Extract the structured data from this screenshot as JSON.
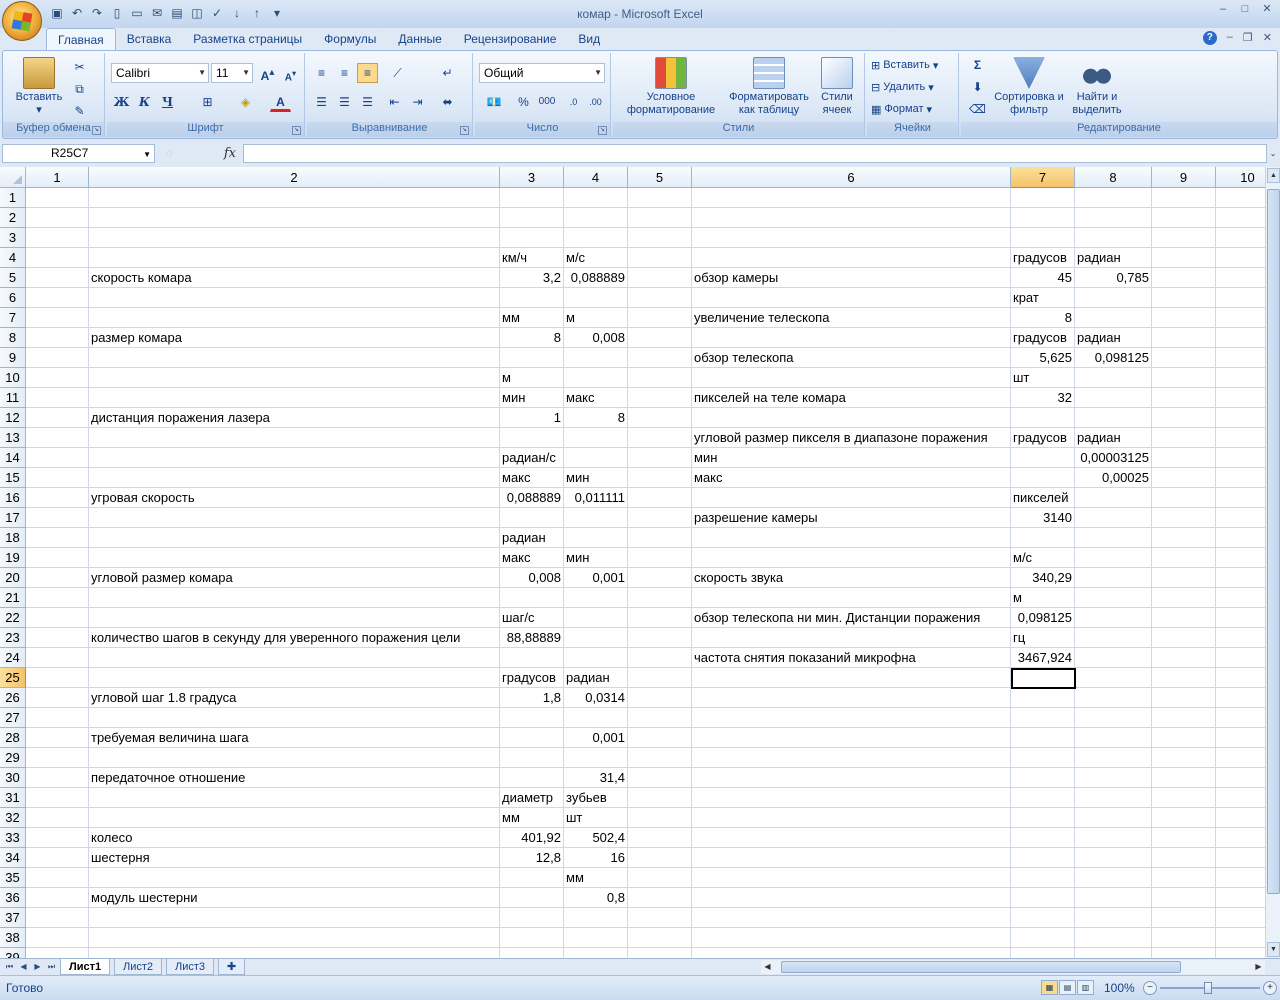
{
  "window": {
    "title": "комар - Microsoft Excel"
  },
  "ribbon": {
    "tabs": [
      "Главная",
      "Вставка",
      "Разметка страницы",
      "Формулы",
      "Данные",
      "Рецензирование",
      "Вид"
    ],
    "clipboard": {
      "paste": "Вставить",
      "label": "Буфер обмена"
    },
    "font": {
      "name": "Calibri",
      "size": "11",
      "label": "Шрифт",
      "bold": "Ж",
      "italic": "К",
      "underline": "Ч"
    },
    "alignment": {
      "label": "Выравнивание"
    },
    "number": {
      "format": "Общий",
      "label": "Число",
      "percent": "%",
      "thousands": "000"
    },
    "styles": {
      "conditional": "Условное форматирование",
      "as_table": "Форматировать как таблицу",
      "cell_styles": "Стили ячеек",
      "label": "Стили"
    },
    "cells": {
      "insert": "Вставить",
      "delete": "Удалить",
      "format": "Формат",
      "label": "Ячейки"
    },
    "editing": {
      "sort": "Сортировка и фильтр",
      "find": "Найти и выделить",
      "label": "Редактирование"
    }
  },
  "formula_bar": {
    "name_box": "R25C7",
    "fx": "fx",
    "formula": ""
  },
  "columns": [
    "1",
    "2",
    "3",
    "4",
    "5",
    "6",
    "7",
    "8",
    "9",
    "10"
  ],
  "rows": [
    "1",
    "2",
    "3",
    "4",
    "5",
    "6",
    "7",
    "8",
    "9",
    "10",
    "11",
    "12",
    "13",
    "14",
    "15",
    "16",
    "17",
    "18",
    "19",
    "20",
    "21",
    "22",
    "23",
    "24",
    "25",
    "26",
    "27",
    "28",
    "29",
    "30",
    "31",
    "32",
    "33",
    "34",
    "35",
    "36",
    "37",
    "38",
    "39"
  ],
  "selected": {
    "row": "25",
    "col": "7"
  },
  "cells": [
    {
      "r": 4,
      "c": 3,
      "v": "км/ч",
      "t": "s"
    },
    {
      "r": 4,
      "c": 4,
      "v": "м/с",
      "t": "s"
    },
    {
      "r": 4,
      "c": 7,
      "v": "градусов",
      "t": "s"
    },
    {
      "r": 4,
      "c": 8,
      "v": "радиан",
      "t": "s"
    },
    {
      "r": 5,
      "c": 2,
      "v": "скорость комара",
      "t": "s"
    },
    {
      "r": 5,
      "c": 3,
      "v": "3,2",
      "t": "n"
    },
    {
      "r": 5,
      "c": 4,
      "v": "0,088889",
      "t": "n"
    },
    {
      "r": 5,
      "c": 6,
      "v": "обзор камеры",
      "t": "s"
    },
    {
      "r": 5,
      "c": 7,
      "v": "45",
      "t": "n"
    },
    {
      "r": 5,
      "c": 8,
      "v": "0,785",
      "t": "n"
    },
    {
      "r": 6,
      "c": 7,
      "v": "крат",
      "t": "s"
    },
    {
      "r": 7,
      "c": 3,
      "v": "мм",
      "t": "s"
    },
    {
      "r": 7,
      "c": 4,
      "v": "м",
      "t": "s"
    },
    {
      "r": 7,
      "c": 6,
      "v": "увеличение телескопа",
      "t": "s"
    },
    {
      "r": 7,
      "c": 7,
      "v": "8",
      "t": "n"
    },
    {
      "r": 8,
      "c": 2,
      "v": "размер комара",
      "t": "s"
    },
    {
      "r": 8,
      "c": 3,
      "v": "8",
      "t": "n"
    },
    {
      "r": 8,
      "c": 4,
      "v": "0,008",
      "t": "n"
    },
    {
      "r": 8,
      "c": 7,
      "v": "градусов",
      "t": "s"
    },
    {
      "r": 8,
      "c": 8,
      "v": "радиан",
      "t": "s"
    },
    {
      "r": 9,
      "c": 6,
      "v": "обзор телескопа",
      "t": "s"
    },
    {
      "r": 9,
      "c": 7,
      "v": "5,625",
      "t": "n"
    },
    {
      "r": 9,
      "c": 8,
      "v": "0,098125",
      "t": "n"
    },
    {
      "r": 10,
      "c": 3,
      "v": "м",
      "t": "s"
    },
    {
      "r": 10,
      "c": 7,
      "v": "шт",
      "t": "s"
    },
    {
      "r": 11,
      "c": 3,
      "v": "мин",
      "t": "s"
    },
    {
      "r": 11,
      "c": 4,
      "v": "макс",
      "t": "s"
    },
    {
      "r": 11,
      "c": 6,
      "v": "пикселей на теле комара",
      "t": "s"
    },
    {
      "r": 11,
      "c": 7,
      "v": "32",
      "t": "n"
    },
    {
      "r": 12,
      "c": 2,
      "v": "дистанция поражения лазера",
      "t": "s"
    },
    {
      "r": 12,
      "c": 3,
      "v": "1",
      "t": "n"
    },
    {
      "r": 12,
      "c": 4,
      "v": "8",
      "t": "n"
    },
    {
      "r": 13,
      "c": 6,
      "v": "угловой размер пикселя в диапазоне поражения",
      "t": "s"
    },
    {
      "r": 13,
      "c": 7,
      "v": "градусов",
      "t": "s"
    },
    {
      "r": 13,
      "c": 8,
      "v": "радиан",
      "t": "s"
    },
    {
      "r": 14,
      "c": 3,
      "v": "радиан/с",
      "t": "s"
    },
    {
      "r": 14,
      "c": 6,
      "v": "мин",
      "t": "s"
    },
    {
      "r": 14,
      "c": 8,
      "v": "0,00003125",
      "t": "n"
    },
    {
      "r": 15,
      "c": 3,
      "v": "макс",
      "t": "s"
    },
    {
      "r": 15,
      "c": 4,
      "v": "мин",
      "t": "s"
    },
    {
      "r": 15,
      "c": 6,
      "v": "макс",
      "t": "s"
    },
    {
      "r": 15,
      "c": 8,
      "v": "0,00025",
      "t": "n"
    },
    {
      "r": 16,
      "c": 2,
      "v": "угровая скорость",
      "t": "s"
    },
    {
      "r": 16,
      "c": 3,
      "v": "0,088889",
      "t": "n"
    },
    {
      "r": 16,
      "c": 4,
      "v": "0,011111",
      "t": "n"
    },
    {
      "r": 16,
      "c": 7,
      "v": "пикселей",
      "t": "s"
    },
    {
      "r": 17,
      "c": 6,
      "v": "разрешение камеры",
      "t": "s"
    },
    {
      "r": 17,
      "c": 7,
      "v": "3140",
      "t": "n"
    },
    {
      "r": 18,
      "c": 3,
      "v": "радиан",
      "t": "s"
    },
    {
      "r": 19,
      "c": 3,
      "v": "макс",
      "t": "s"
    },
    {
      "r": 19,
      "c": 4,
      "v": "мин",
      "t": "s"
    },
    {
      "r": 19,
      "c": 7,
      "v": "м/с",
      "t": "s"
    },
    {
      "r": 20,
      "c": 2,
      "v": "угловой размер комара",
      "t": "s"
    },
    {
      "r": 20,
      "c": 3,
      "v": "0,008",
      "t": "n"
    },
    {
      "r": 20,
      "c": 4,
      "v": "0,001",
      "t": "n"
    },
    {
      "r": 20,
      "c": 6,
      "v": "скорость звука",
      "t": "s"
    },
    {
      "r": 20,
      "c": 7,
      "v": "340,29",
      "t": "n"
    },
    {
      "r": 21,
      "c": 7,
      "v": "м",
      "t": "s"
    },
    {
      "r": 22,
      "c": 3,
      "v": "шаг/с",
      "t": "s"
    },
    {
      "r": 22,
      "c": 6,
      "v": "обзор телескопа ни мин. Дистанции поражения",
      "t": "s"
    },
    {
      "r": 22,
      "c": 7,
      "v": "0,098125",
      "t": "n"
    },
    {
      "r": 23,
      "c": 2,
      "v": "количество шагов в секунду для уверенного поражения цели",
      "t": "s"
    },
    {
      "r": 23,
      "c": 3,
      "v": "88,88889",
      "t": "n"
    },
    {
      "r": 23,
      "c": 7,
      "v": "гц",
      "t": "s"
    },
    {
      "r": 24,
      "c": 6,
      "v": "частота снятия показаний микрофна",
      "t": "s"
    },
    {
      "r": 24,
      "c": 7,
      "v": "3467,924",
      "t": "n"
    },
    {
      "r": 25,
      "c": 3,
      "v": "градусов",
      "t": "s"
    },
    {
      "r": 25,
      "c": 4,
      "v": "радиан",
      "t": "s"
    },
    {
      "r": 26,
      "c": 2,
      "v": "угловой шаг 1.8 градуса",
      "t": "s"
    },
    {
      "r": 26,
      "c": 3,
      "v": "1,8",
      "t": "n"
    },
    {
      "r": 26,
      "c": 4,
      "v": "0,0314",
      "t": "n"
    },
    {
      "r": 28,
      "c": 2,
      "v": "требуемая величина шага",
      "t": "s"
    },
    {
      "r": 28,
      "c": 4,
      "v": "0,001",
      "t": "n"
    },
    {
      "r": 30,
      "c": 2,
      "v": "передаточное отношение",
      "t": "s"
    },
    {
      "r": 30,
      "c": 4,
      "v": "31,4",
      "t": "n"
    },
    {
      "r": 31,
      "c": 3,
      "v": "диаметр",
      "t": "s"
    },
    {
      "r": 31,
      "c": 4,
      "v": "зубьев",
      "t": "s"
    },
    {
      "r": 32,
      "c": 3,
      "v": "мм",
      "t": "s"
    },
    {
      "r": 32,
      "c": 4,
      "v": "шт",
      "t": "s"
    },
    {
      "r": 33,
      "c": 2,
      "v": "колесо",
      "t": "s"
    },
    {
      "r": 33,
      "c": 3,
      "v": "401,92",
      "t": "n"
    },
    {
      "r": 33,
      "c": 4,
      "v": "502,4",
      "t": "n"
    },
    {
      "r": 34,
      "c": 2,
      "v": "шестерня",
      "t": "s"
    },
    {
      "r": 34,
      "c": 3,
      "v": "12,8",
      "t": "n"
    },
    {
      "r": 34,
      "c": 4,
      "v": "16",
      "t": "n"
    },
    {
      "r": 35,
      "c": 4,
      "v": "мм",
      "t": "s"
    },
    {
      "r": 36,
      "c": 2,
      "v": "модуль шестерни",
      "t": "s"
    },
    {
      "r": 36,
      "c": 4,
      "v": "0,8",
      "t": "n"
    }
  ],
  "sheet_tabs": [
    "Лист1",
    "Лист2",
    "Лист3"
  ],
  "active_sheet": "Лист1",
  "status": {
    "text": "Готово",
    "zoom": "100%"
  }
}
